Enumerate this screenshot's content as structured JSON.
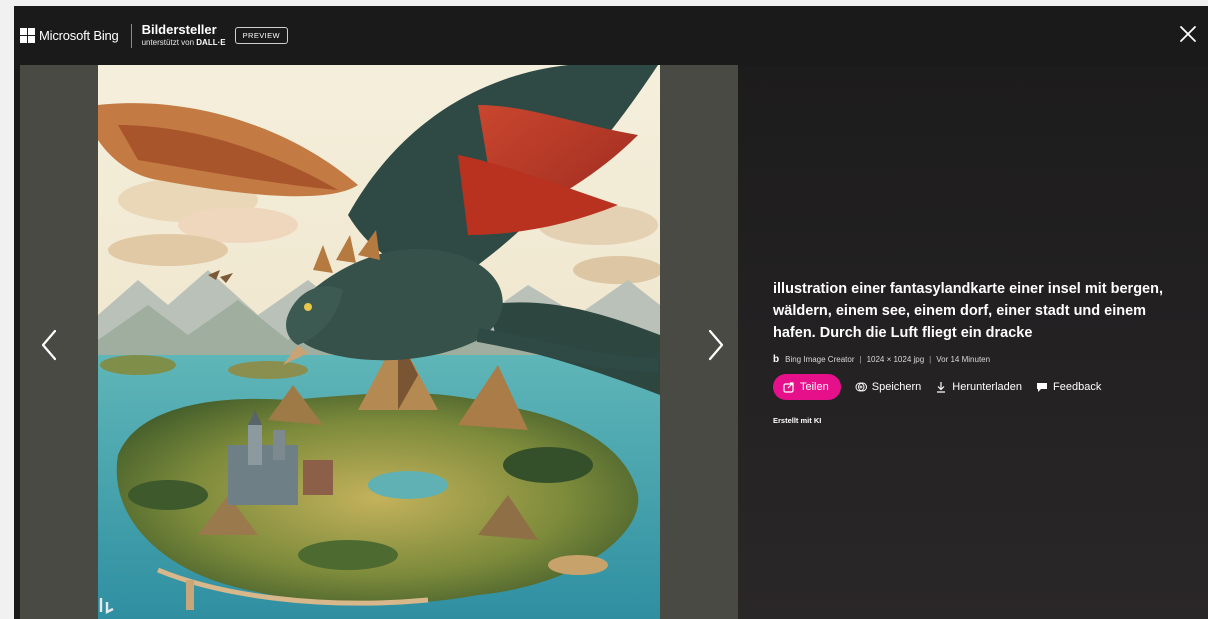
{
  "header": {
    "brand_text": "Microsoft Bing",
    "product_title": "Bildersteller",
    "product_sub_prefix": "unterstützt von",
    "product_sub_model": "DALL·E",
    "badge": "PREVIEW",
    "icons": {
      "logo": "microsoft-logo",
      "close": "close-icon"
    }
  },
  "viewer": {
    "icons": {
      "prev": "chevron-left-icon",
      "next": "chevron-right-icon",
      "watermark": "bing-watermark-icon"
    }
  },
  "details": {
    "prompt": "illustration einer fantasylandkarte einer insel mit bergen, wäldern, einem see, einem dorf, einer stadt und einem hafen. Durch die Luft fliegt ein dracke",
    "meta": {
      "source": "Bing Image Creator",
      "separator": "|",
      "dimensions": "1024 × 1024 jpg",
      "age": "Vor 14 Minuten"
    },
    "actions": {
      "share": "Teilen",
      "save": "Speichern",
      "download": "Herunterladen",
      "feedback": "Feedback"
    },
    "ai_note": "Erstellt mit KI"
  },
  "colors": {
    "accent": "#e6118a",
    "header_bg": "#1a1a1a",
    "panel_bg": "#232122"
  }
}
